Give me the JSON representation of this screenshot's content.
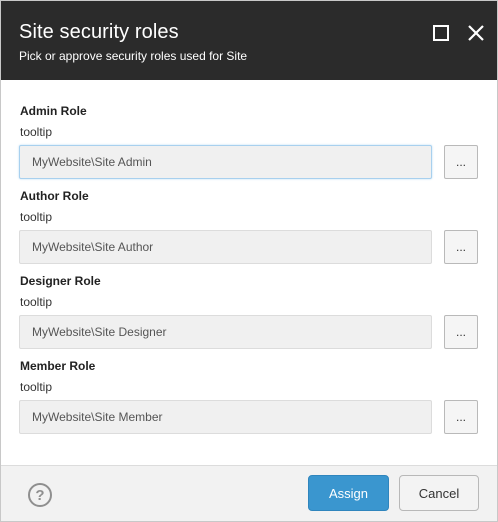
{
  "dialog": {
    "title": "Site security roles",
    "subtitle": "Pick or approve security roles used for Site"
  },
  "fields": [
    {
      "label": "Admin Role",
      "tooltip": "tooltip",
      "value": "MyWebsite\\Site Admin",
      "browse_label": "..."
    },
    {
      "label": "Author Role",
      "tooltip": "tooltip",
      "value": "MyWebsite\\Site Author",
      "browse_label": "..."
    },
    {
      "label": "Designer Role",
      "tooltip": "tooltip",
      "value": "MyWebsite\\Site Designer",
      "browse_label": "..."
    },
    {
      "label": "Member Role",
      "tooltip": "tooltip",
      "value": "MyWebsite\\Site Member",
      "browse_label": "..."
    }
  ],
  "footer": {
    "help_glyph": "?",
    "assign_label": "Assign",
    "cancel_label": "Cancel"
  },
  "colors": {
    "header_bg": "#2b2b2b",
    "primary_button": "#3a96cf",
    "footer_bg": "#f2f2f2"
  },
  "icons": [
    "maximize-icon",
    "close-icon",
    "help-icon"
  ]
}
